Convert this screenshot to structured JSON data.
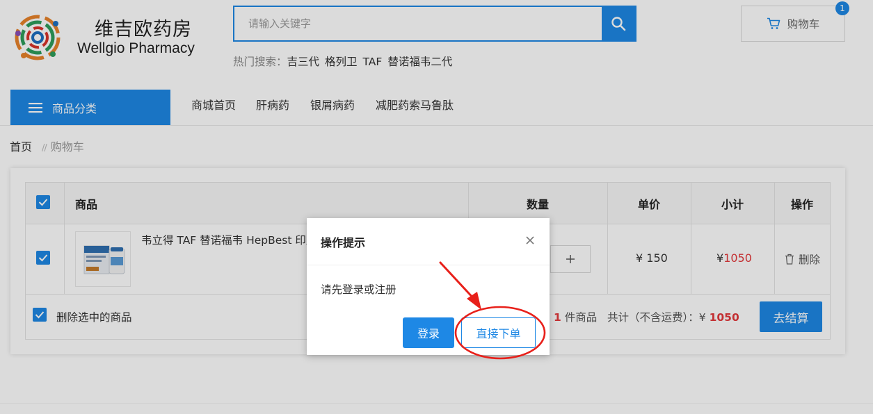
{
  "header": {
    "brand_cn": "维吉欧药房",
    "brand_en": "Wellgio Pharmacy",
    "search_placeholder": "请输入关键字",
    "hot_label": "热门搜索：",
    "hot_items": [
      "吉三代",
      "格列卫",
      "TAF",
      "替诺福韦二代"
    ],
    "cart_label": "购物车",
    "cart_count": "1"
  },
  "nav": {
    "category_label": "商品分类",
    "items": [
      "商城首页",
      "肝病药",
      "银屑病药",
      "减肥药索马鲁肽"
    ]
  },
  "breadcrumb": {
    "home": "首页",
    "separator": "//",
    "current": "购物车"
  },
  "cart": {
    "columns": {
      "product": "商品",
      "quantity": "数量",
      "unit_price": "单价",
      "subtotal": "小计",
      "action": "操作"
    },
    "item": {
      "name": "韦立得 TAF 替诺福韦 HepBest 印度",
      "price": "¥ 150",
      "subtotal_symbol": "¥",
      "subtotal_value": "1050",
      "delete_label": "删除"
    },
    "footer": {
      "delete_selected": "删除选中的商品",
      "count": "1",
      "count_suffix": "件商品",
      "total_label": "共计（不含运费）：¥",
      "total_value": "1050",
      "checkout_label": "去结算"
    }
  },
  "dialog": {
    "title": "操作提示",
    "message": "请先登录或注册",
    "login_label": "登录",
    "direct_order_label": "直接下单"
  },
  "colors": {
    "primary": "#1e88e5",
    "price_red": "#e4393c",
    "annotation_red": "#e8201a"
  }
}
